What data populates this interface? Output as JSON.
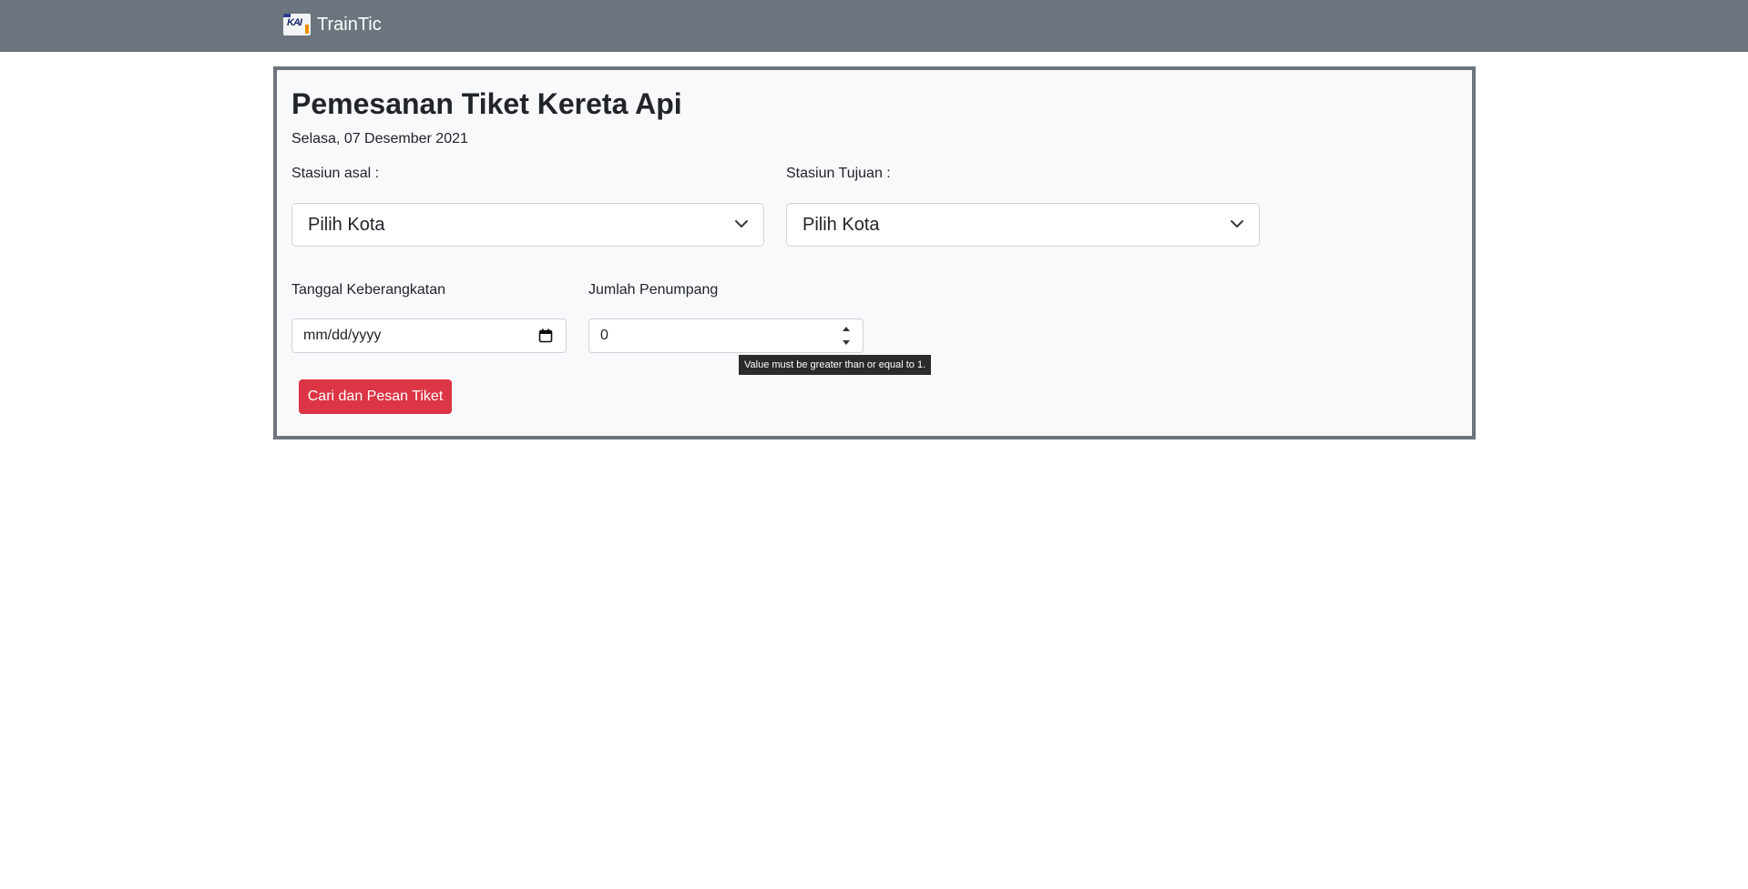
{
  "navbar": {
    "brand_logo_text": "KAI",
    "brand_name": "TrainTic"
  },
  "form": {
    "title": "Pemesanan Tiket Kereta Api",
    "date": "Selasa, 07 Desember 2021",
    "origin": {
      "label": "Stasiun asal :",
      "selected": "Pilih Kota"
    },
    "destination": {
      "label": "Stasiun Tujuan :",
      "selected": "Pilih Kota"
    },
    "departure_date": {
      "label": "Tanggal Keberangkatan",
      "placeholder": "mm/dd/yyyy"
    },
    "passengers": {
      "label": "Jumlah Penumpang",
      "value": "0",
      "validation_tooltip": "Value must be greater than or equal to 1."
    },
    "submit_label": "Cari dan Pesan Tiket"
  },
  "icons": {
    "select_arrow": "chevron-down-icon",
    "date_picker": "calendar-icon",
    "spinner": "spinner-arrows-icon"
  },
  "colors": {
    "navbar_bg": "#6c757d",
    "card_bg": "#f8f9fa",
    "card_border": "#6c757d",
    "button_bg": "#dc3545",
    "tooltip_bg": "#2b2b2b"
  }
}
